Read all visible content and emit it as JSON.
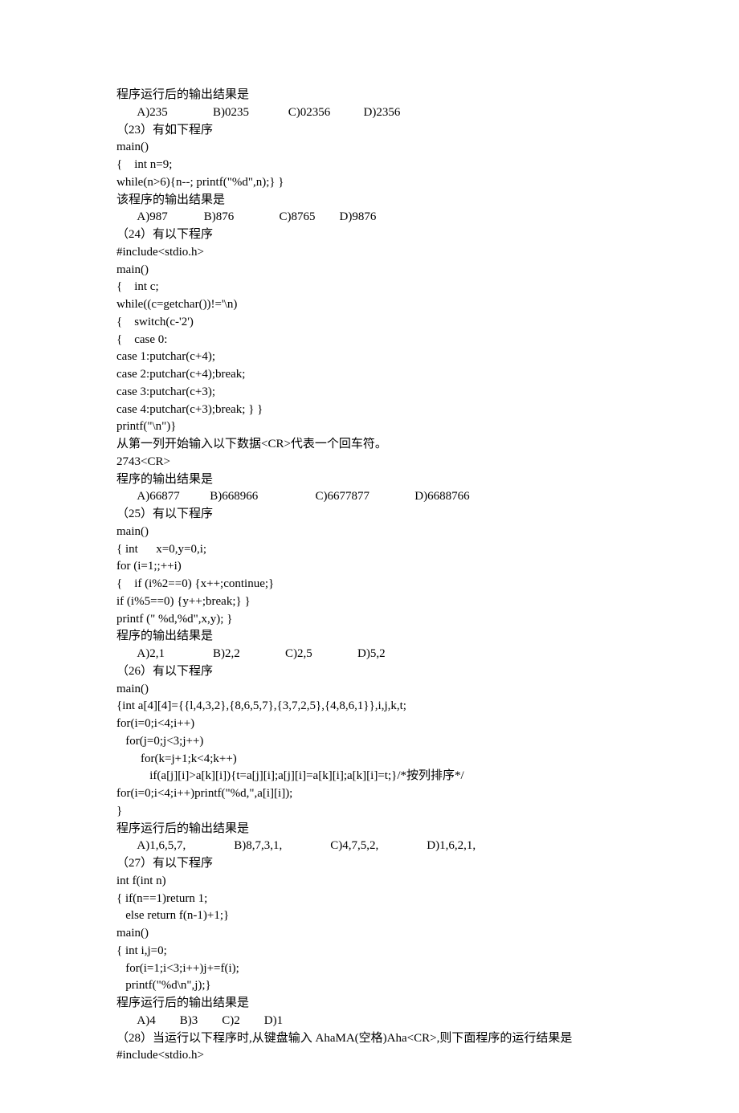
{
  "lines": [
    "程序运行后的输出结果是",
    "       A)235               B)0235             C)02356           D)2356",
    "（23）有如下程序",
    "main()",
    "{    int n=9;",
    "while(n>6){n--; printf(\"%d\",n);} }",
    "该程序的输出结果是",
    "       A)987            B)876               C)8765        D)9876",
    "（24）有以下程序",
    "#include<stdio.h>",
    "main()",
    "{    int c;",
    "while((c=getchar())!='\\n)",
    "{    switch(c-'2')",
    "{    case 0:",
    "case 1:putchar(c+4);",
    "case 2:putchar(c+4);break;",
    "case 3:putchar(c+3);",
    "case 4:putchar(c+3);break; } }",
    "printf(\"\\n\")}",
    "从第一列开始输入以下数据<CR>代表一个回车符。",
    "2743<CR>",
    "程序的输出结果是",
    "       A)66877          B)668966                   C)6677877               D)6688766",
    "（25）有以下程序",
    "main()",
    "{ int      x=0,y=0,i;",
    "for (i=1;;++i)",
    "{    if (i%2==0) {x++;continue;}",
    "if (i%5==0) {y++;break;} }",
    "printf (\" %d,%d\",x,y); }",
    "程序的输出结果是",
    "       A)2,1                B)2,2               C)2,5               D)5,2",
    "（26）有以下程序",
    "main()",
    "{int a[4][4]={{l,4,3,2},{8,6,5,7},{3,7,2,5},{4,8,6,1}},i,j,k,t;",
    "for(i=0;i<4;i++)",
    "   for(j=0;j<3;j++)",
    "        for(k=j+1;k<4;k++)",
    "           if(a[j][i]>a[k][i]){t=a[j][i];a[j][i]=a[k][i];a[k][i]=t;}/*按列排序*/",
    "for(i=0;i<4;i++)printf(\"%d,\",a[i][i]);",
    "}",
    "程序运行后的输出结果是",
    "       A)1,6,5,7,                B)8,7,3,1,                C)4,7,5,2,                D)1,6,2,1,",
    "（27）有以下程序",
    "int f(int n)",
    "{ if(n==1)return 1;",
    "   else return f(n-1)+1;}",
    "main()",
    "{ int i,j=0;",
    "   for(i=1;i<3;i++)j+=f(i);",
    "   printf(\"%d\\n\",j);}",
    "程序运行后的输出结果是",
    "       A)4        B)3        C)2        D)1",
    "（28）当运行以下程序时,从键盘输入 AhaMA(空格)Aha<CR>,则下面程序的运行结果是",
    "#include<stdio.h>"
  ]
}
